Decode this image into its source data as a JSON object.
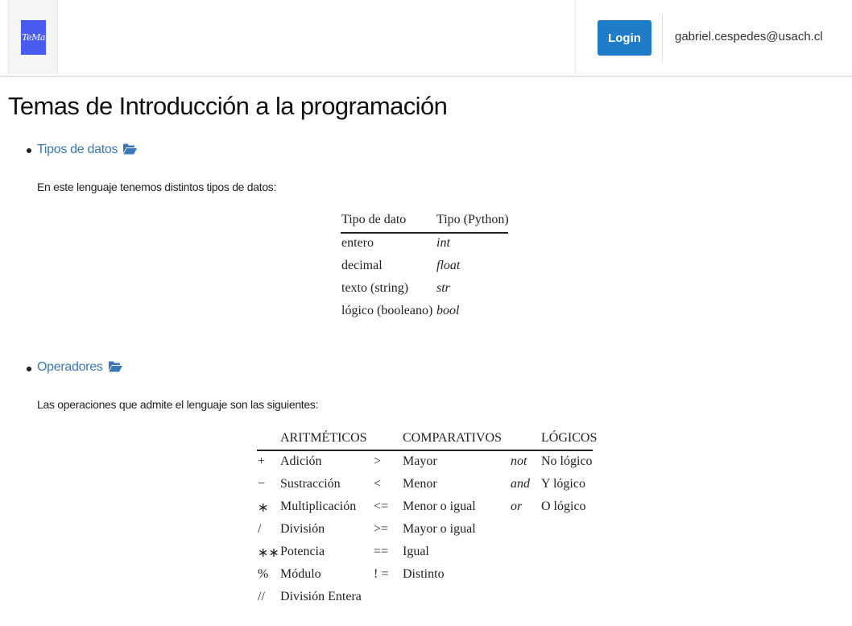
{
  "header": {
    "logo_text": "TeMa",
    "login_label": "Login",
    "user_email": "gabriel.cespedes@usach.cl"
  },
  "page": {
    "title": "Temas de Introducción a la programación"
  },
  "topics": [
    {
      "label": "Tipos de datos",
      "description": "En este lenguaje tenemos distintos tipos de datos:",
      "table": {
        "headers": [
          "Tipo de dato",
          "Tipo (Python)"
        ],
        "rows": [
          [
            "entero",
            "int"
          ],
          [
            "decimal",
            "float"
          ],
          [
            "texto (string)",
            "str"
          ],
          [
            "lógico (booleano)",
            "bool"
          ]
        ]
      }
    },
    {
      "label": "Operadores",
      "description": "Las operaciones que admite el lenguaje son las siguientes:",
      "table": {
        "headers": [
          "ARITMÉTICOS",
          "COMPARATIVOS",
          "LÓGICOS"
        ],
        "arithmetic": [
          [
            "+",
            "Adición"
          ],
          [
            "−",
            "Sustracción"
          ],
          [
            "∗",
            "Multiplicación"
          ],
          [
            "/",
            "División"
          ],
          [
            "∗∗",
            "Potencia"
          ],
          [
            "%",
            "Módulo"
          ],
          [
            "//",
            "División Entera"
          ]
        ],
        "comparative": [
          [
            ">",
            "Mayor"
          ],
          [
            "<",
            "Menor"
          ],
          [
            "<=",
            "Menor o igual"
          ],
          [
            ">=",
            "Mayor o igual"
          ],
          [
            "==",
            "Igual"
          ],
          [
            "! =",
            "Distinto"
          ]
        ],
        "logical": [
          [
            "not",
            "No lógico"
          ],
          [
            "and",
            "Y lógico"
          ],
          [
            "or",
            "O lógico"
          ]
        ]
      }
    }
  ],
  "colors": {
    "link": "#3a78b5",
    "button": "#1e7cc8",
    "logo": "#4a5cf0"
  }
}
